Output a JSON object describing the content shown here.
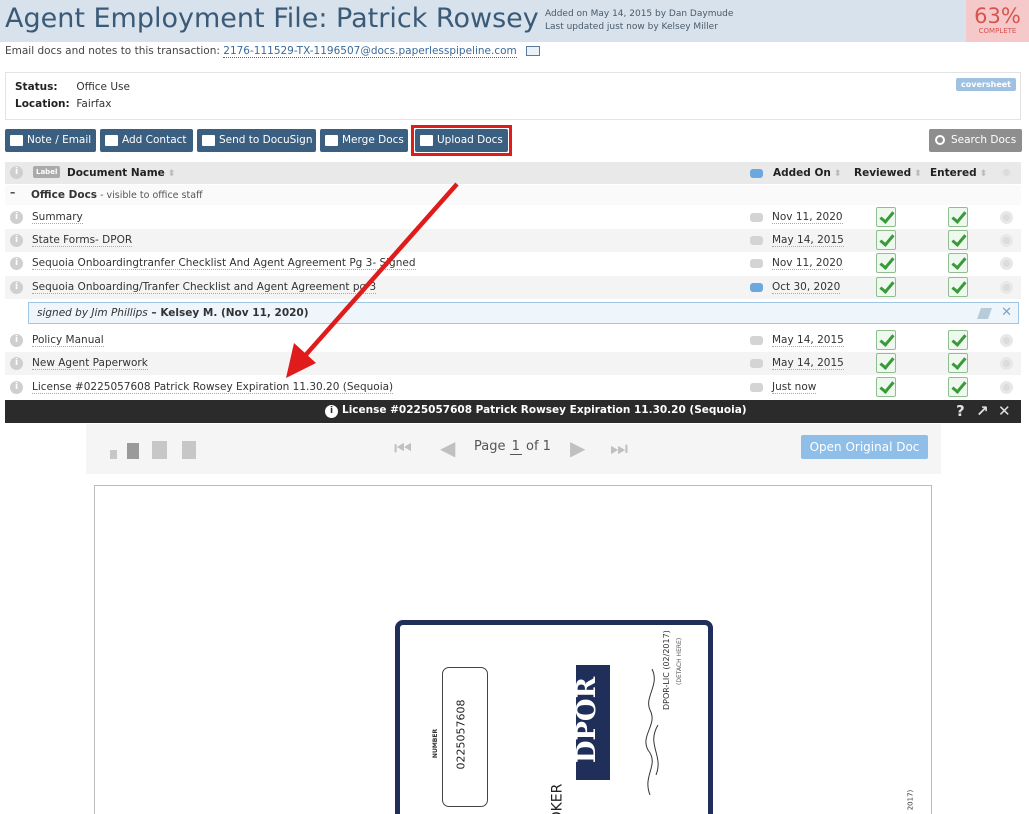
{
  "header": {
    "title": "Agent Employment File: Patrick Rowsey",
    "added": "Added on May 14, 2015 by Dan Daymude",
    "updated": "Last updated just now by Kelsey Miller",
    "percent": "63%",
    "percent_label": "COMPLETE"
  },
  "email": {
    "prefix": "Email docs and notes to this transaction:",
    "address": "2176-111529-TX-1196507@docs.paperlesspipeline.com"
  },
  "status": {
    "status_label": "Status:",
    "status_value": "Office Use",
    "location_label": "Location:",
    "location_value": "Fairfax",
    "coversheet": "coversheet"
  },
  "toolbar": {
    "note_email": "Note / Email",
    "add_contact": "Add Contact",
    "docusign": "Send to DocuSign",
    "merge": "Merge Docs",
    "upload": "Upload Docs",
    "search": "Search Docs"
  },
  "table": {
    "label_chip": "Label",
    "col_document": "Document Name",
    "col_added": "Added On",
    "col_reviewed": "Reviewed",
    "col_entered": "Entered",
    "group_name": "Office Docs",
    "group_sub": " - visible to office staff",
    "group_toggle": "–",
    "rows": [
      {
        "name": "Summary",
        "date": "Nov 11, 2020"
      },
      {
        "name": "State Forms- DPOR",
        "date": "May 14, 2015"
      },
      {
        "name": "Sequoia Onboardingtranfer Checklist And Agent Agreement Pg 3- Signed",
        "date": "Nov 11, 2020"
      },
      {
        "name": "Sequoia Onboarding/Tranfer Checklist and Agent Agreement pg 3",
        "date": "Oct 30, 2020"
      },
      {
        "name": "Policy Manual",
        "date": "May 14, 2015"
      },
      {
        "name": "New Agent Paperwork",
        "date": "May 14, 2015"
      },
      {
        "name": "License #0225057608 Patrick Rowsey Expiration 11.30.20 (Sequoia)",
        "date": "Just now"
      }
    ],
    "note": {
      "signed": "signed by Jim Phillips",
      "by": " – Kelsey M. (Nov 11, 2020)"
    }
  },
  "viewer": {
    "title": "License #0225057608 Patrick Rowsey Expiration 11.30.20 (Sequoia)",
    "page_prefix": "Page ",
    "page_num": "1",
    "page_suffix": " of 1",
    "open_original": "Open Original Doc",
    "help": "?"
  },
  "license": {
    "number_label": "NUMBER",
    "number": "0225057608",
    "logo": "DPOR",
    "code": "DPOR-LIC (02/2017)",
    "detach": "(DETACH HERE)",
    "broker": "OKER",
    "year": "2017)"
  },
  "colors": {
    "header_bg": "#d7e2ec",
    "title": "#3a5a78",
    "button": "#3b5f80",
    "highlight": "#e01b1b",
    "percent": "#d9534f",
    "check": "#3a9a3a"
  }
}
